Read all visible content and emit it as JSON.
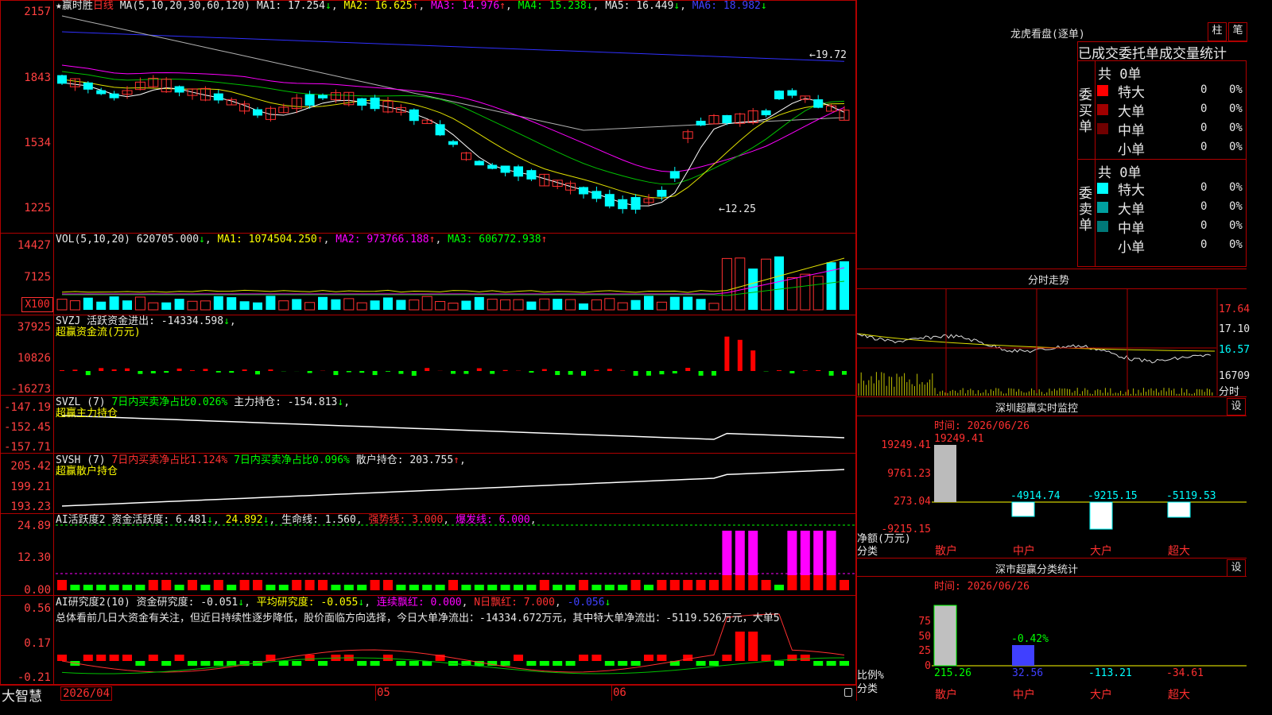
{
  "main": {
    "header": {
      "name": "赢时胜",
      "period": "日线",
      "ma_label": "MA(5,10,20,30,60,120)",
      "ma1": "MA1: 17.254",
      "ma2": "MA2: 16.625",
      "ma3": "MA3: 14.976",
      "ma4": "MA4: 15.238",
      "ma5": "MA5: 16.449",
      "ma6": "MA6: 18.982"
    },
    "y_labels": [
      "2157",
      "1843",
      "1534",
      "1225"
    ],
    "annot_high": "19.72",
    "annot_low": "12.25"
  },
  "vol": {
    "label": "VOL(5,10,20)",
    "value": "620705.000",
    "ma1": "MA1: 1074504.250",
    "ma2": "MA2: 973766.188",
    "ma3": "MA3: 606772.938",
    "y_labels": [
      "14427",
      "7125"
    ],
    "unit": "X100"
  },
  "svzj": {
    "label": "SVZJ",
    "l1": "活跃资金进出: -14334.598",
    "sub": "超赢资金流(万元)",
    "y_labels": [
      "37925",
      "10826",
      "-16273"
    ]
  },
  "svzl": {
    "label": "SVZL (7)",
    "l1": "7日内买卖净占比0.026%",
    "l2": "主力持仓: -154.813",
    "sub": "超赢主力持仓",
    "y_labels": [
      "-147.19",
      "-152.45",
      "-157.71"
    ]
  },
  "svsh": {
    "label": "SVSH (7)",
    "l1": "7日内买卖净占比1.124%",
    "l2": "7日内买卖净占比0.096%",
    "l3": "散户持仓: 203.755",
    "sub": "超赢散户持仓",
    "y_labels": [
      "205.42",
      "199.21",
      "193.23"
    ]
  },
  "ai1": {
    "label": "AI活跃度2",
    "l1": "资金活跃度: 6.481",
    "l2": "24.892",
    "l3": "生命线: 1.560",
    "l4": "强势线: 3.000",
    "l5": "爆发线: 6.000",
    "y_labels": [
      "24.89",
      "12.30",
      "0.00"
    ]
  },
  "ai2": {
    "label": "AI研究度2(10)",
    "l1": "资金研究度: -0.051",
    "l2": "平均研究度: -0.055",
    "l3": "连续飘红: 0.000",
    "l4": "N日飘红: 7.000",
    "l5": "-0.056",
    "text": "总体看前几日大资金有关注，但近日持续性逐步降低，股价面临方向选择，今日大单净流出：-14334.672万元，其中特大单净流出：-5119.526万元，大单5",
    "y_labels": [
      "0.56",
      "0.17",
      "-0.21"
    ]
  },
  "bottom": {
    "brand": "大智慧",
    "date1": "2026/04",
    "m5": "05",
    "m6": "06"
  },
  "right": {
    "lhkp": {
      "title": "龙虎看盘(逐单)",
      "btn1": "柱",
      "btn2": "笔",
      "headline": "已成交委托单成交量统计",
      "buy": {
        "side": "委买单",
        "total": "共 0单",
        "rows": [
          {
            "name": "特大",
            "v": "0",
            "p": "0%",
            "c": "#ff0000"
          },
          {
            "name": "大单",
            "v": "0",
            "p": "0%",
            "c": "#a00000"
          },
          {
            "name": "中单",
            "v": "0",
            "p": "0%",
            "c": "#700000"
          },
          {
            "name": "小单",
            "v": "0",
            "p": "0%",
            "c": "#000000"
          }
        ]
      },
      "sell": {
        "side": "委卖单",
        "total": "共 0单",
        "rows": [
          {
            "name": "特大",
            "v": "0",
            "p": "0%",
            "c": "#00ffff"
          },
          {
            "name": "大单",
            "v": "0",
            "p": "0%",
            "c": "#00a0a0"
          },
          {
            "name": "中单",
            "v": "0",
            "p": "0%",
            "c": "#007878"
          },
          {
            "name": "小单",
            "v": "0",
            "p": "0%",
            "c": "#000000"
          }
        ]
      }
    },
    "fs": {
      "title": "分时走势",
      "y": [
        "17.64",
        "17.10",
        "16.57"
      ],
      "vol": "16709",
      "unit": "分时"
    },
    "sz": {
      "title": "深圳超赢实时监控",
      "btn": "设",
      "time": "时间: 2026/06/26",
      "y": [
        "19249.41",
        "9761.23",
        "273.04",
        "-9215.15"
      ],
      "ylab1": "净额(万元)",
      "ylab2": "分类",
      "vals": [
        "19249.41",
        "-4914.74",
        "-9215.15",
        "-5119.53"
      ],
      "cats": [
        "散户",
        "中户",
        "大户",
        "超大"
      ]
    },
    "sc": {
      "title": "深市超赢分类统计",
      "btn": "设",
      "time": "时间: 2026/06/26",
      "y": [
        "75",
        "50",
        "25",
        "0"
      ],
      "ylab1": "比例%",
      "ylab2": "分类",
      "top": "-0.42%",
      "vals": [
        "215.26",
        "32.56",
        "-113.21",
        "-34.61"
      ],
      "cats": [
        "散户",
        "中户",
        "大户",
        "超大"
      ]
    }
  }
}
